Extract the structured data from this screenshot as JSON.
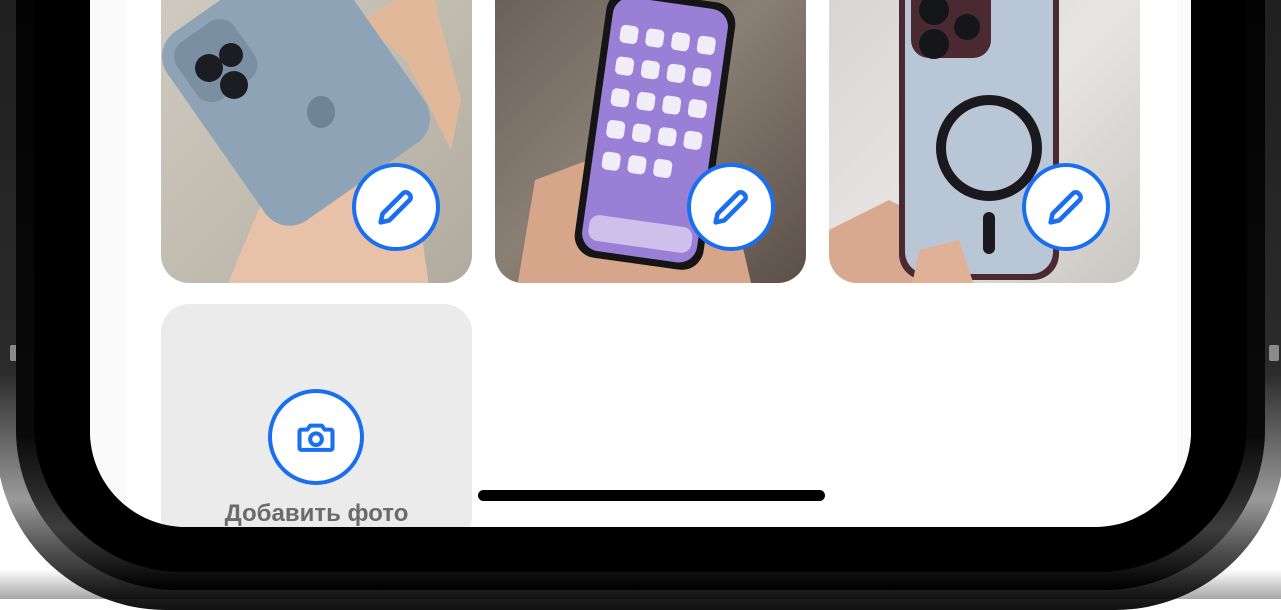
{
  "photos": [
    {
      "icon": "pencil-icon",
      "subject": "phone-back"
    },
    {
      "icon": "pencil-icon",
      "subject": "phone-homescreen"
    },
    {
      "icon": "pencil-icon",
      "subject": "phone-case"
    }
  ],
  "add_photo": {
    "icon": "camera-icon",
    "label": "Добавить фото"
  },
  "colors": {
    "accent": "#1a6ff0",
    "tile_background": "#ebebeb",
    "label_text": "#6b6b6b"
  }
}
